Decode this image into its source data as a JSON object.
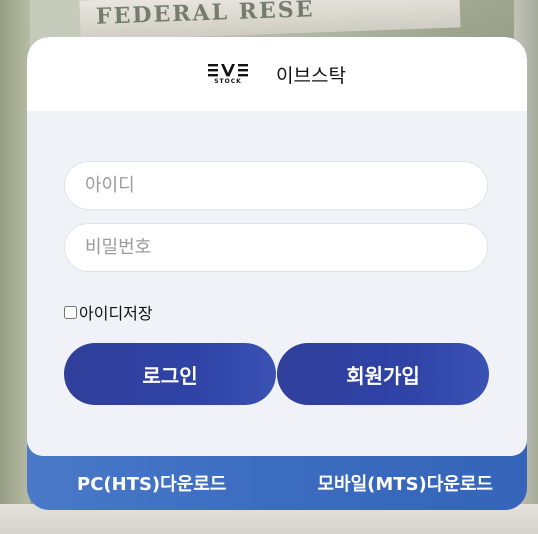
{
  "background": {
    "banknote_text": "FEDERAL RESE"
  },
  "header": {
    "logo_word": "STOCK",
    "brand_name": "이브스탁"
  },
  "login_form": {
    "id_placeholder": "아이디",
    "password_placeholder": "비밀번호",
    "remember_id_label": "아이디저장",
    "remember_id_checked": false,
    "login_button": "로그인",
    "signup_button": "회원가입"
  },
  "footer": {
    "pc_download": "PC(HTS)다운로드",
    "mobile_download": "모바일(MTS)다운로드"
  },
  "colors": {
    "primary_button": "#2f42a6",
    "footer_blue": "#3b6cc0",
    "panel_bg": "#f1f2f7"
  }
}
